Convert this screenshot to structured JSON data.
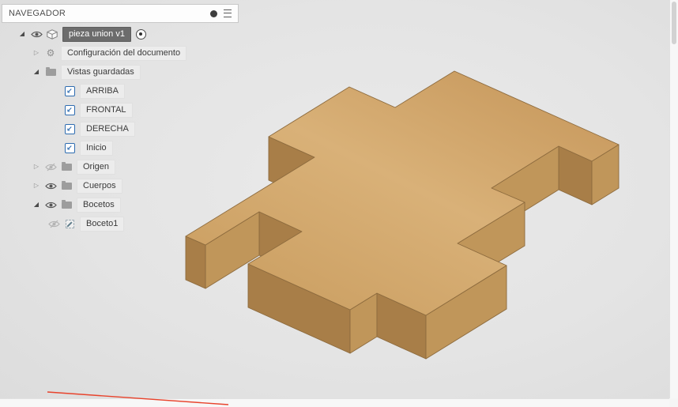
{
  "panel": {
    "title": "NAVEGADOR"
  },
  "icons": {
    "pin": "filled-circle",
    "menu": "menu-bars",
    "caret_expanded": "◢",
    "caret_collapsed": "▷",
    "eye_visible": "eye-outline",
    "eye_hidden": "eye-slashed",
    "component": "cube",
    "document_settings": "⚙",
    "folder": "folder",
    "saved_view": "↙",
    "sketch": "pencil-dashed-square",
    "active_component": "circle-dot"
  },
  "tree": {
    "root": {
      "label": "pieza union v1"
    },
    "items": [
      {
        "label": "Configuración del documento"
      },
      {
        "label": "Vistas guardadas"
      },
      {
        "label": "ARRIBA"
      },
      {
        "label": "FRONTAL"
      },
      {
        "label": "DERECHA"
      },
      {
        "label": "Inicio"
      },
      {
        "label": "Origen"
      },
      {
        "label": "Cuerpos"
      },
      {
        "label": "Bocetos"
      },
      {
        "label": "Boceto1"
      }
    ]
  },
  "canvas": {
    "colors": {
      "background": "#e5e5e5",
      "face_top_right": "#c6975b",
      "face_top_mid": "#d9b178",
      "face_top_left": "#cb9f62",
      "face_se": "#c0965a",
      "face_sw": "#a87e48",
      "edge": "#8d6b3e",
      "axis_x": "#e8432c"
    }
  }
}
